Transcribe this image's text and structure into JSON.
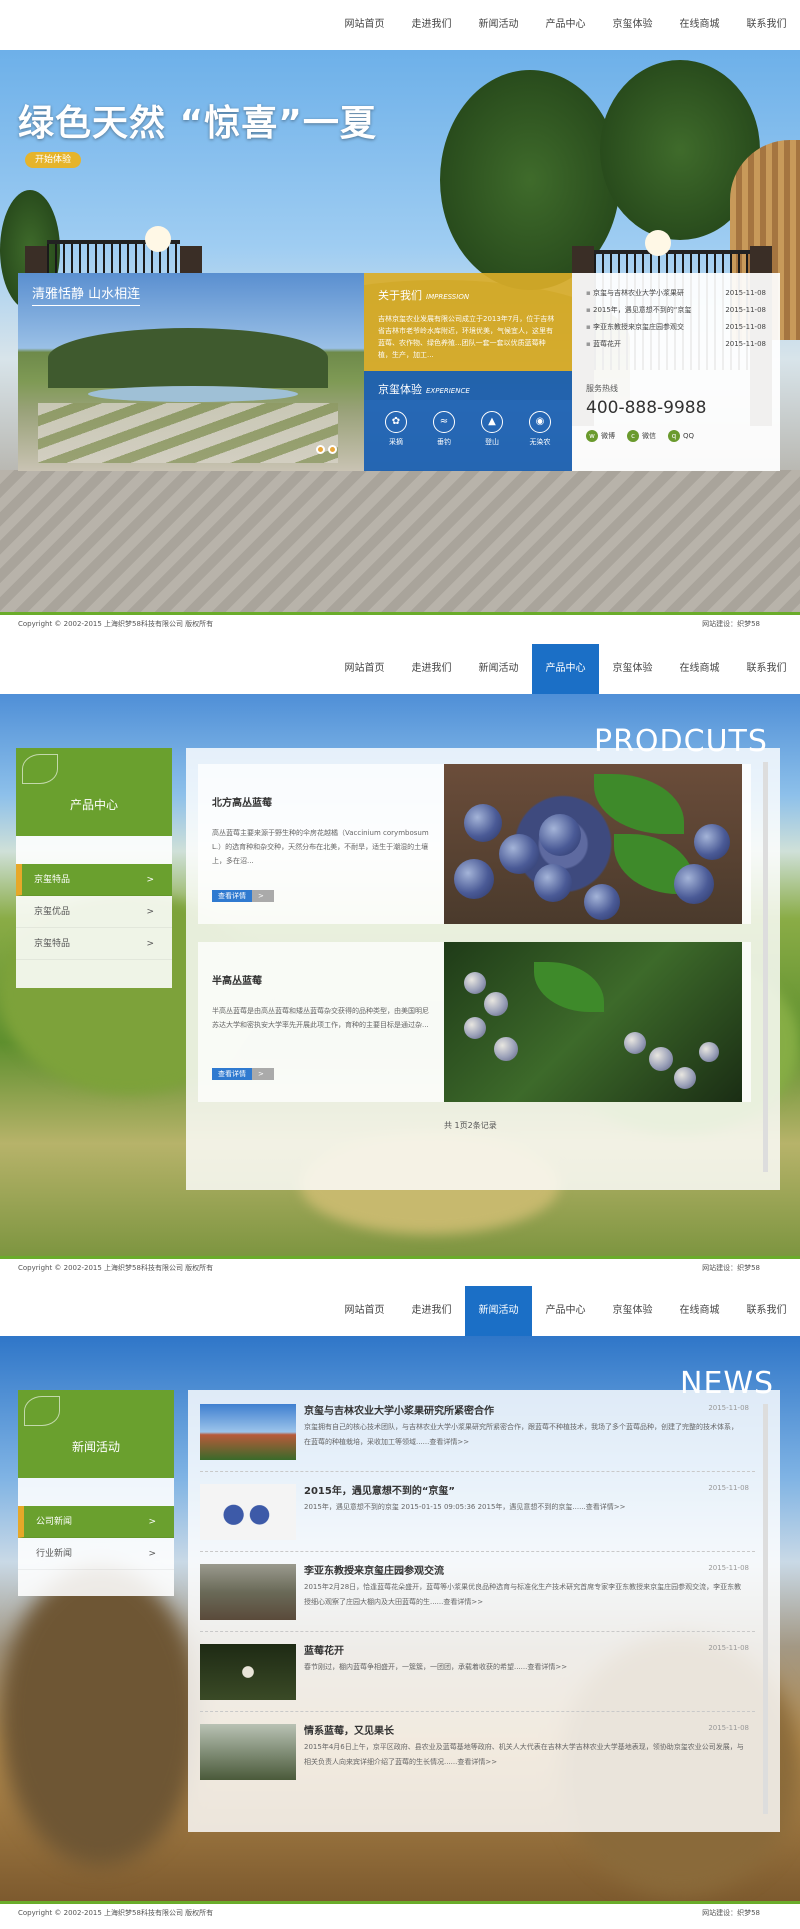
{
  "nav": {
    "items": [
      "网站首页",
      "走进我们",
      "新闻活动",
      "产品中心",
      "京玺体验",
      "在线商城",
      "联系我们"
    ]
  },
  "section1": {
    "hero_title": "绿色天然  “惊喜”一夏",
    "hero_tag": "开始体验",
    "photo_caption": "清雅恬静 山水相连",
    "about": {
      "title": "关于我们",
      "title_en": "IMPRESSION",
      "text": "吉林京玺农业发展有限公司成立于2013年7月，位于吉林省吉林市老爷岭水库附近，环境优美，气候宜人，这里有蓝莓、农作物、绿色养殖...团队一套一套以优质蓝莓种植，生产，加工..."
    },
    "experience": {
      "title": "京玺体验",
      "title_en": "EXPERIENCE",
      "items": [
        {
          "label": "采摘",
          "icon": "picking-icon"
        },
        {
          "label": "垂钓",
          "icon": "fishing-icon"
        },
        {
          "label": "登山",
          "icon": "mountain-icon"
        },
        {
          "label": "无染农",
          "icon": "eye-icon"
        }
      ]
    },
    "news": [
      {
        "title": "京玺与吉林农业大学小浆果研",
        "date": "2015-11-08"
      },
      {
        "title": "2015年，遇见意想不到的“京玺",
        "date": "2015-11-08"
      },
      {
        "title": "李亚东教授来京玺庄园参观交",
        "date": "2015-11-08"
      },
      {
        "title": "蓝莓花开",
        "date": "2015-11-08"
      }
    ],
    "hotline_label": "服务热线",
    "hotline": "400-888-9988",
    "social": [
      "微博",
      "微信",
      "QQ"
    ]
  },
  "footer": {
    "copyright": "Copyright © 2002-2015 上海织梦58科技有限公司 版权所有",
    "builder": "网站建设：织梦58"
  },
  "section2": {
    "big_title": "PRODCUTS",
    "sidebar_title": "产品中心",
    "sidebar_items": [
      "京玺特品",
      "京玺优品",
      "京玺特品"
    ],
    "products": [
      {
        "title": "北方高丛蓝莓",
        "desc": "高丛蓝莓主要来源于野生种的伞房花越橘（Vaccinium corymbosum L.）的选育种和杂交种，天然分布在北美，不耐旱，适生于潮湿的土壤上，多在沼...",
        "more": "查看详情"
      },
      {
        "title": "半高丛蓝莓",
        "desc": "半高丛蓝莓是由高丛蓝莓和矮丛蓝莓杂交获得的品种类型，由美国明尼苏达大学和密执安大学率先开展此项工作，育种的主要目标是通过杂...",
        "more": "查看详情"
      }
    ],
    "pager": "共 1页2条记录"
  },
  "section3": {
    "big_title": "NEWS",
    "sidebar_title": "新闻活动",
    "sidebar_items": [
      "公司新闻",
      "行业新闻"
    ],
    "news": [
      {
        "title": "京玺与吉林农业大学小浆果研究所紧密合作",
        "date": "2015-11-08",
        "desc": "京玺拥有自己的核心技术团队，与吉林农业大学小浆果研究所紧密合作，跟蓝莓不种植技术，我场了多个蓝莓品种，创建了完整的技术体系，在蓝莓的种植栽培，采收加工等领域......查看详情>>"
      },
      {
        "title": "2015年，遇见意想不到的“京玺”",
        "date": "2015-11-08",
        "desc": "2015年，遇见意想不到的京玺 2015-01-15 09:05:36 2015年，遇见意想不到的京玺......查看详情>>"
      },
      {
        "title": "李亚东教授来京玺庄园参观交流",
        "date": "2015-11-08",
        "desc": "2015年2月28日，恰逢蓝莓花朵盛开，蓝莓等小浆果优良品种选育与标准化生产技术研究首席专家李亚东教授来京玺庄园参观交流，李亚东教授细心观察了庄园大棚内及大田蓝莓的生......查看详情>>"
      },
      {
        "title": "蓝莓花开",
        "date": "2015-11-08",
        "desc": "春节刚过，棚内蓝莓争相盛开，一簇簇，一团团，承载着收获的希望......查看详情>>"
      },
      {
        "title": "情系蓝莓，又见果长",
        "date": "2015-11-08",
        "desc": "2015年4月6日上午，京平区政府、县农业及蓝莓基地等政府、机关人大代表在吉林大学吉林农业大学基地表现，领协助京玺农业公司发展，与相关负责人向来宾详细介绍了蓝莓的生长情况......查看详情>>"
      }
    ]
  }
}
